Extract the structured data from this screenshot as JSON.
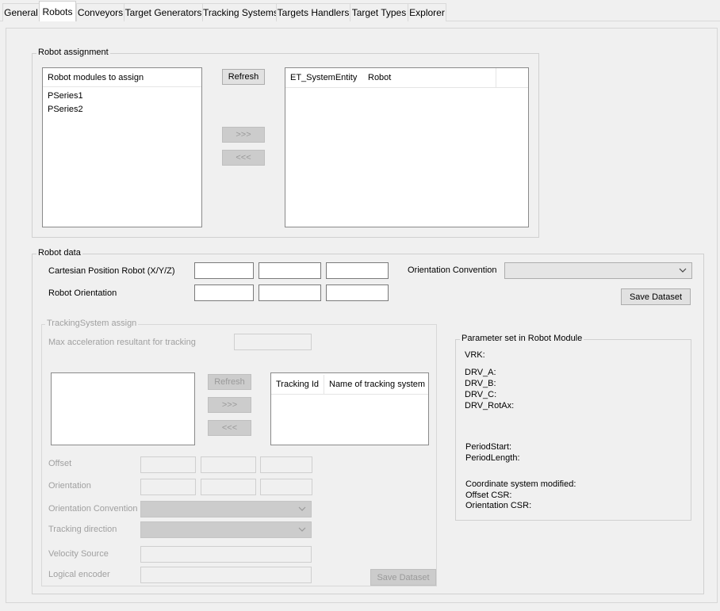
{
  "tabs": [
    {
      "label": "General"
    },
    {
      "label": "Robots"
    },
    {
      "label": "Conveyors"
    },
    {
      "label": "Target Generators"
    },
    {
      "label": "Tracking Systems"
    },
    {
      "label": "Targets Handlers"
    },
    {
      "label": "Target Types"
    },
    {
      "label": "Explorer"
    }
  ],
  "robot_assignment": {
    "title": "Robot assignment",
    "modules_list": {
      "header": "Robot modules to assign",
      "items": [
        "PSeries1",
        "PSeries2"
      ]
    },
    "refresh_label": "Refresh",
    "assign_label": ">>>",
    "unassign_label": "<<<",
    "assigned_table": {
      "columns": [
        "ET_SystemEntity",
        "Robot",
        ""
      ]
    }
  },
  "robot_data": {
    "title": "Robot data",
    "cartesian_label": "Cartesian Position Robot (X/Y/Z)",
    "cartesian_values": [
      "",
      "",
      ""
    ],
    "orientation_label": "Robot Orientation",
    "orientation_values": [
      "",
      "",
      ""
    ],
    "orientation_convention_label": "Orientation  Convention",
    "orientation_convention_value": "",
    "save_label": "Save Dataset",
    "tracking": {
      "title": "TrackingSystem assign",
      "max_accel_label": "Max acceleration resultant for tracking",
      "max_accel_value": "",
      "refresh_label": "Refresh",
      "assign_label": ">>>",
      "unassign_label": "<<<",
      "columns": [
        "Tracking Id",
        "Name of tracking system"
      ],
      "offset_label": "Offset",
      "orientation_label": "Orientation",
      "orientation_convention_label": "Orientation Convention",
      "tracking_direction_label": "Tracking direction",
      "velocity_source_label": "Velocity Source",
      "logical_encoder_label": "Logical encoder",
      "save_label": "Save Dataset"
    },
    "parameter_set": {
      "title": "Parameter set in Robot Module",
      "vrk": "VRK:",
      "drv_a": "DRV_A:",
      "drv_b": "DRV_B:",
      "drv_c": "DRV_C:",
      "drv_rotax": "DRV_RotAx:",
      "period_start": "PeriodStart:",
      "period_length": "PeriodLength:",
      "coord_modified": "Coordinate system modified:",
      "offset_csr": "Offset CSR:",
      "orientation_csr": "Orientation CSR:"
    }
  }
}
